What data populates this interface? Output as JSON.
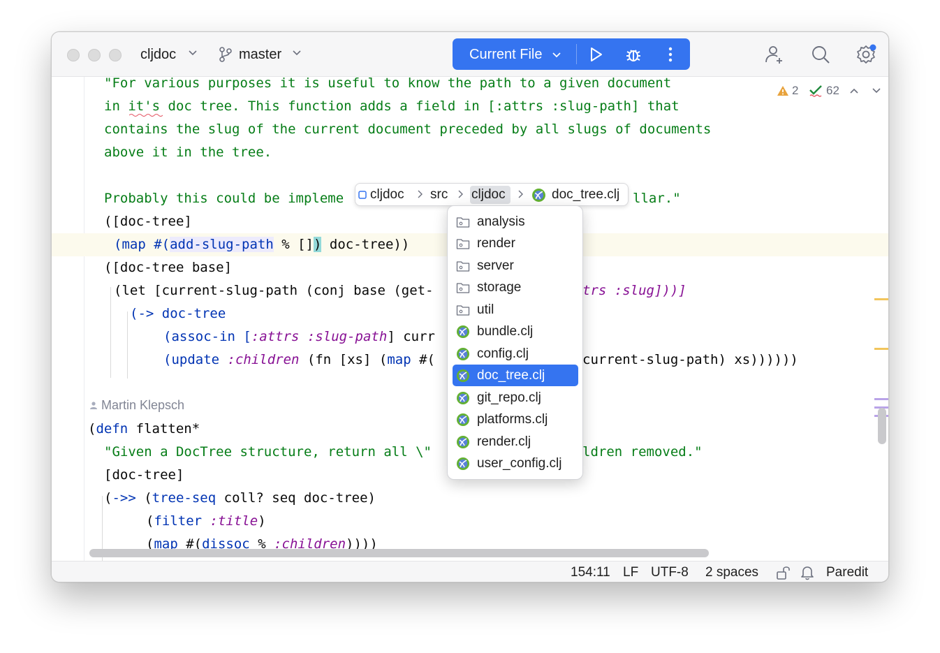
{
  "titlebar": {
    "project": "cljdoc",
    "branch": "master",
    "run_config": "Current File"
  },
  "inspection": {
    "warnings": "2",
    "checks": "62"
  },
  "code_lines": [
    "\"For various purposes it is useful to know the path to a given document",
    "in it's doc tree. This function adds a field in [:attrs :slug-path] that",
    "contains the slug of the current document preceded by all slugs of documents",
    "above it in the tree.",
    "Probably this could be impleme",
    "llar.\"",
    "([doc-tree]",
    "(map #(",
    "add-slug-path",
    " % []",
    ")",
    " doc-tree))",
    "([doc-tree base]",
    "(let [current-slug-path (conj base (get-",
    "trs :slug]))]",
    "(-> doc-tree",
    "(assoc-in [",
    ":attrs :slug-path",
    "] curr",
    "(update ",
    ":children",
    " (fn [xs] (",
    "map",
    " #(",
    "current-slug-path) xs))))))",
    "(defn flatten*",
    "\"Given a DocTree structure, return all \\\"",
    "ldren removed.\"",
    "[doc-tree]",
    "(->> (tree-seq coll? seq doc-tree)",
    "(filter :title)",
    "(map #(dissoc % :children))))"
  ],
  "author": "Martin Klepsch",
  "breadcrumb": [
    "cljdoc",
    "src",
    "cljdoc",
    "doc_tree.clj"
  ],
  "popup": {
    "selected_index": 7,
    "items": [
      {
        "label": "analysis",
        "icon": "folder-icon"
      },
      {
        "label": "render",
        "icon": "folder-icon"
      },
      {
        "label": "server",
        "icon": "folder-icon"
      },
      {
        "label": "storage",
        "icon": "folder-icon"
      },
      {
        "label": "util",
        "icon": "folder-icon"
      },
      {
        "label": "bundle.clj",
        "icon": "clojure-file-icon"
      },
      {
        "label": "config.clj",
        "icon": "clojure-file-icon"
      },
      {
        "label": "doc_tree.clj",
        "icon": "clojure-file-icon"
      },
      {
        "label": "git_repo.clj",
        "icon": "clojure-file-icon"
      },
      {
        "label": "platforms.clj",
        "icon": "clojure-file-icon"
      },
      {
        "label": "render.clj",
        "icon": "clojure-file-icon"
      },
      {
        "label": "user_config.clj",
        "icon": "clojure-file-icon"
      }
    ]
  },
  "statusbar": {
    "position": "154:11",
    "line_separator": "LF",
    "encoding": "UTF-8",
    "indent": "2 spaces",
    "mode": "Paredit"
  },
  "colors": {
    "accent": "#3574f0",
    "string": "#067d17",
    "keyword": "#0033b3",
    "clojure_keyword": "#871094",
    "warning": "#e8a33d",
    "check": "#208a3c"
  }
}
